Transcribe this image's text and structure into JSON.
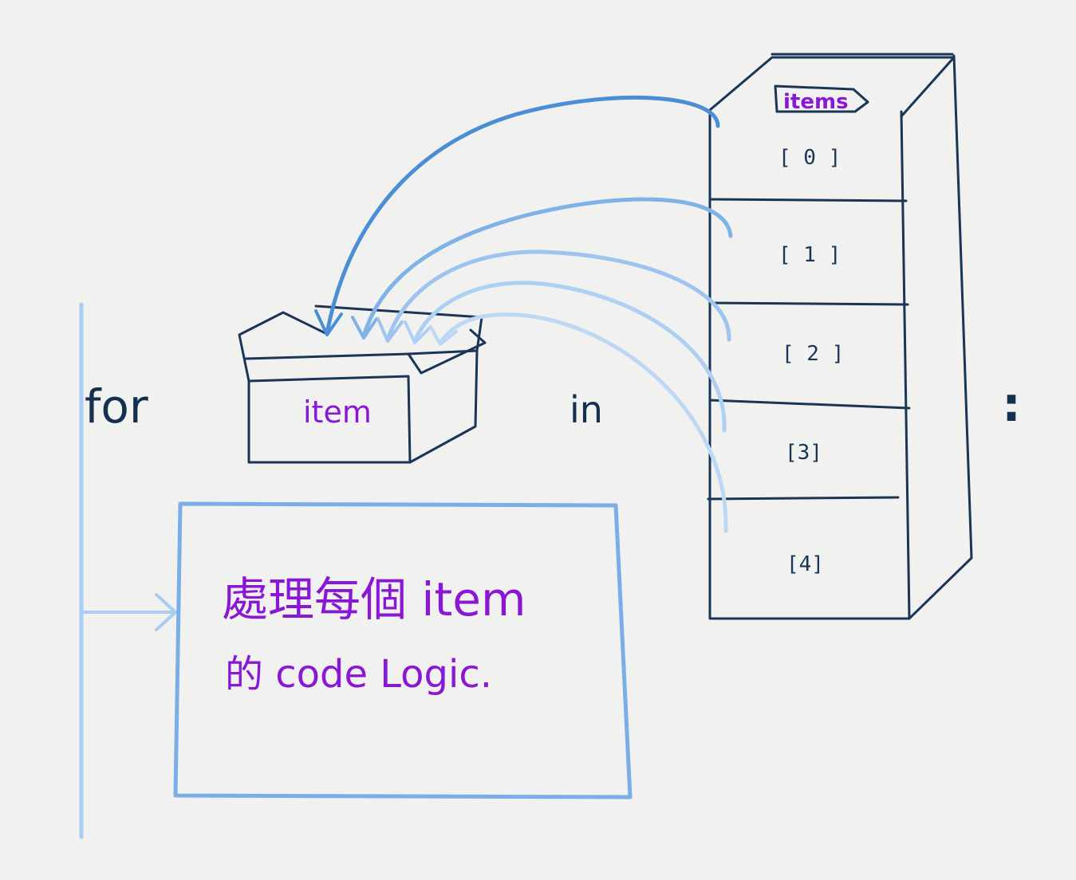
{
  "diagram": {
    "keyword_for": "for",
    "keyword_in": "in",
    "colon": ":",
    "loop_variable": "item",
    "collection_tag": "items",
    "indices": [
      "[ 0 ]",
      "[ 1 ]",
      "[ 2 ]",
      "[3]",
      "[4]"
    ],
    "body_line_1": "處理每個 item",
    "body_line_2": "的 code Logic."
  },
  "colors": {
    "ink": "#1a3556",
    "text_purple": "#8a17d6",
    "arrow_blue_strong": "#4a8fd6",
    "arrow_blue_light": "#a9cdf2",
    "body_box_blue": "#7aaee6"
  }
}
